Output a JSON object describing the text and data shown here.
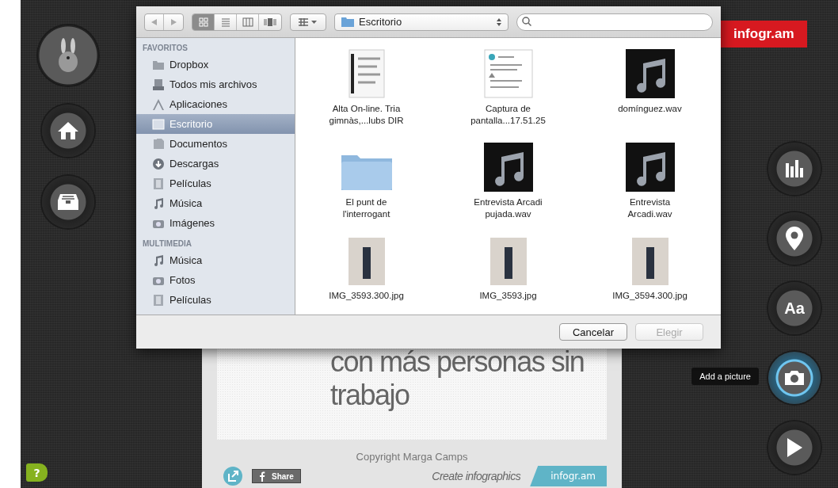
{
  "left_rail": {
    "buttons": [
      {
        "kind": "mascot"
      },
      {
        "kind": "home"
      },
      {
        "kind": "inbox"
      }
    ],
    "help": "?"
  },
  "logo": "infogr.am",
  "dialog": {
    "toolbar": {
      "view_modes": [
        {
          "selected": true
        },
        {
          "selected": false
        },
        {
          "selected": false
        },
        {
          "selected": false
        }
      ],
      "location": "Escritorio"
    },
    "sidebar": [
      {
        "title": "FAVORITOS",
        "items": [
          {
            "label": "Dropbox",
            "kind": "folder",
            "selected": false
          },
          {
            "label": "Todos mis archivos",
            "kind": "files",
            "selected": false
          },
          {
            "label": "Aplicaciones",
            "kind": "apps",
            "selected": false
          },
          {
            "label": "Escritorio",
            "kind": "desktop",
            "selected": true
          },
          {
            "label": "Documentos",
            "kind": "docs",
            "selected": false
          },
          {
            "label": "Descargas",
            "kind": "download",
            "selected": false
          },
          {
            "label": "Películas",
            "kind": "film",
            "selected": false
          },
          {
            "label": "Música",
            "kind": "music",
            "selected": false
          },
          {
            "label": "Imágenes",
            "kind": "camera",
            "selected": false
          }
        ]
      },
      {
        "title": "MULTIMEDIA",
        "items": [
          {
            "label": "Música",
            "kind": "music",
            "selected": false
          },
          {
            "label": "Fotos",
            "kind": "camera",
            "selected": false
          },
          {
            "label": "Películas",
            "kind": "film",
            "selected": false
          }
        ]
      }
    ],
    "files": [
      {
        "name": "Alta On-line. Tria gimnàs,...lubs DIR",
        "kind": "document"
      },
      {
        "name": "Captura de pantalla...17.51.25",
        "kind": "screenshot"
      },
      {
        "name": "domínguez.wav",
        "kind": "audio"
      },
      {
        "name": "El punt de l'interrogant",
        "kind": "folder"
      },
      {
        "name": "Entrevista Arcadi pujada.wav",
        "kind": "audio"
      },
      {
        "name": "Entrevista Arcadi.wav",
        "kind": "audio"
      },
      {
        "name": "IMG_3593.300.jpg",
        "kind": "photo"
      },
      {
        "name": "IMG_3593.jpg",
        "kind": "photo"
      },
      {
        "name": "IMG_3594.300.jpg",
        "kind": "photo"
      }
    ],
    "buttons": [
      {
        "label": "Cancelar",
        "disabled": false
      },
      {
        "label": "Elegir",
        "disabled": true
      }
    ]
  },
  "infographic": {
    "title_lines": [
      "con más personas sin",
      "trabajo"
    ],
    "copyright": "Copyright Marga Camps",
    "share": "Share",
    "tagline": "Create infographics",
    "badge": "infogr.am"
  },
  "right_rail": {
    "tools": [
      {
        "kind": "chart",
        "active": false
      },
      {
        "kind": "pin",
        "active": false
      },
      {
        "kind": "text",
        "label": "Aa",
        "active": false
      },
      {
        "kind": "camera",
        "active": true,
        "tooltip": "Add a picture"
      },
      {
        "kind": "play",
        "active": false
      }
    ]
  }
}
